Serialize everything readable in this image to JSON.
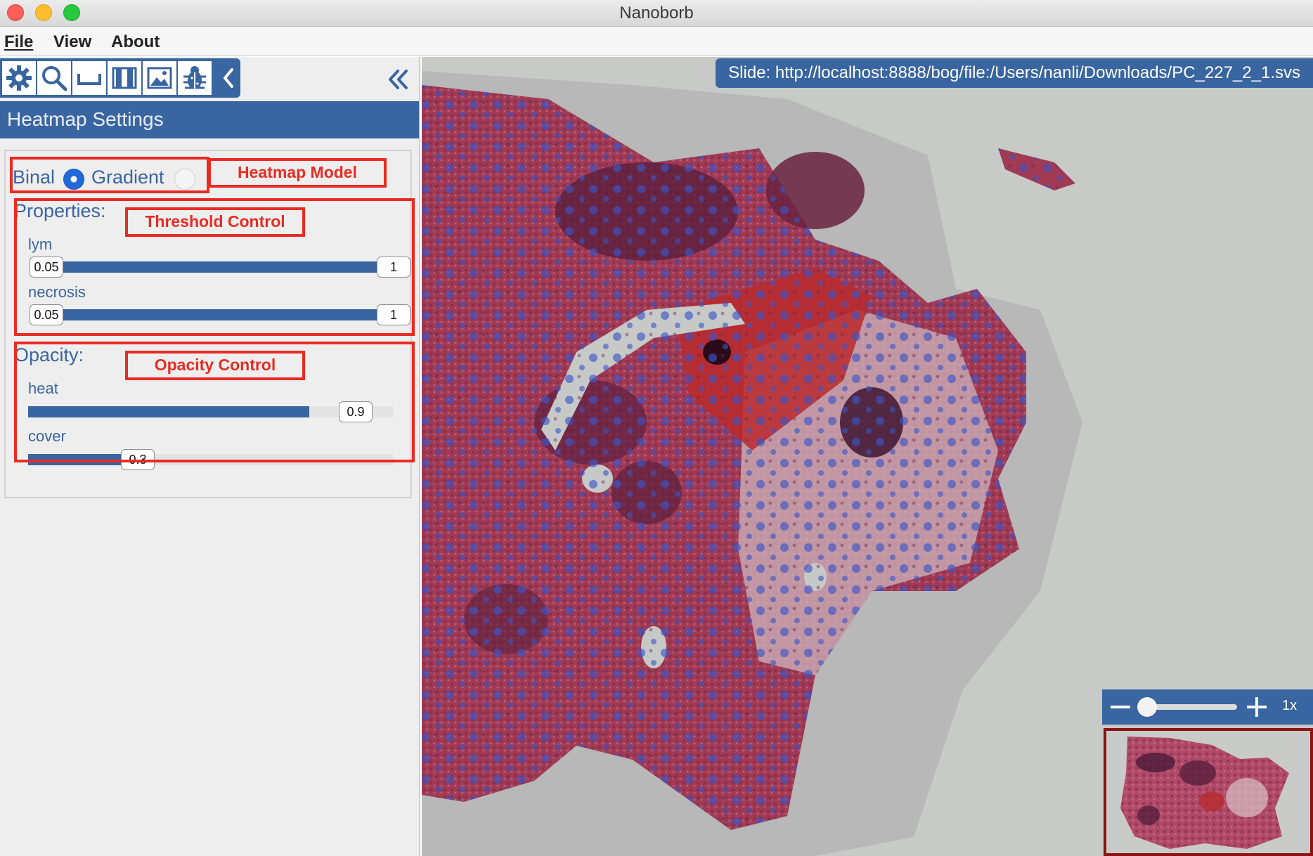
{
  "window": {
    "title": "Nanoborb"
  },
  "menu": {
    "file": "File",
    "view": "View",
    "about": "About"
  },
  "toolbar": {
    "tools": [
      "gear-icon",
      "search-icon",
      "ruler-icon",
      "panels-icon",
      "image-icon",
      "bug-icon",
      "chevron-left-icon"
    ],
    "collapse": "double-chevron-left-icon"
  },
  "panel": {
    "title": "Heatmap Settings",
    "model": {
      "binal": "Binal",
      "gradient": "Gradient",
      "selected": "Binal"
    },
    "properties": {
      "label": "Properties:",
      "items": [
        {
          "name": "lym",
          "min": "0.05",
          "max": "1"
        },
        {
          "name": "necrosis",
          "min": "0.05",
          "max": "1"
        }
      ]
    },
    "opacity": {
      "label": "Opacity:",
      "items": [
        {
          "name": "heat",
          "value": "0.9",
          "fraction": 0.9
        },
        {
          "name": "cover",
          "value": "0.3",
          "fraction": 0.3
        }
      ]
    }
  },
  "annotations": {
    "heatmap_model": "Heatmap Model",
    "threshold_control": "Threshold Control",
    "opacity_control": "Opacity Control"
  },
  "viewer": {
    "slide_label": "Slide: http://localhost:8888/bog/file:/Users/nanli/Downloads/PC_227_2_1.svs",
    "zoom": "1x",
    "zoom_slider_fraction": 0.0
  },
  "colors": {
    "accent": "#3965a0",
    "annotation": "#e82c23",
    "tissue": "#a03a55",
    "heat": "#3a55c8"
  }
}
